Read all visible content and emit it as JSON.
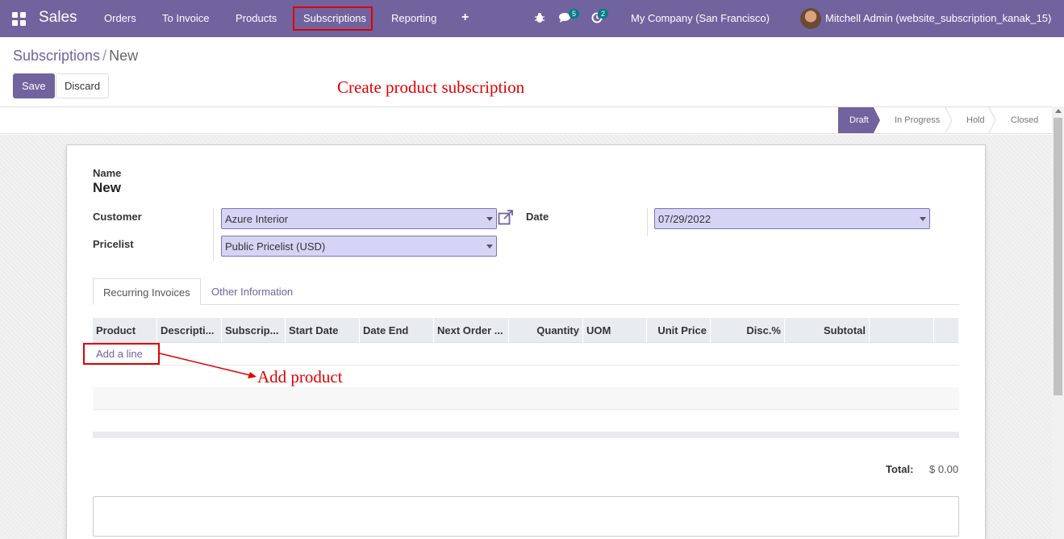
{
  "navbar": {
    "app_name": "Sales",
    "menu": [
      "Orders",
      "To Invoice",
      "Products",
      "Subscriptions",
      "Reporting"
    ],
    "activity_badge": "5",
    "messages_badge": "2",
    "company": "My Company (San Francisco)",
    "user": "Mitchell Admin (website_subscription_kanak_15)"
  },
  "breadcrumb": {
    "parent": "Subscriptions",
    "separator": "/",
    "current": "New"
  },
  "buttons": {
    "save": "Save",
    "discard": "Discard"
  },
  "annotations": {
    "title": "Create product subscription",
    "add_product": "Add product"
  },
  "statusbar": {
    "stages": [
      "Draft",
      "In Progress",
      "Hold",
      "Closed"
    ],
    "active": "Draft"
  },
  "form": {
    "name_label": "Name",
    "name_value": "New",
    "customer_label": "Customer",
    "customer_value": "Azure Interior",
    "pricelist_label": "Pricelist",
    "pricelist_value": "Public Pricelist (USD)",
    "date_label": "Date",
    "date_value": "07/29/2022"
  },
  "tabs": [
    "Recurring Invoices",
    "Other Information"
  ],
  "table": {
    "columns": [
      "Product",
      "Descripti...",
      "Subscrip...",
      "Start Date",
      "Date End",
      "Next Order ...",
      "Quantity",
      "UOM",
      "Unit Price",
      "Disc.%",
      "Subtotal"
    ],
    "add_line": "Add a line"
  },
  "totals": {
    "label": "Total:",
    "value": "$ 0.00"
  },
  "colors": {
    "brand": "#71639e",
    "annotation": "#e00000",
    "field_bg": "#d6d4f5"
  }
}
